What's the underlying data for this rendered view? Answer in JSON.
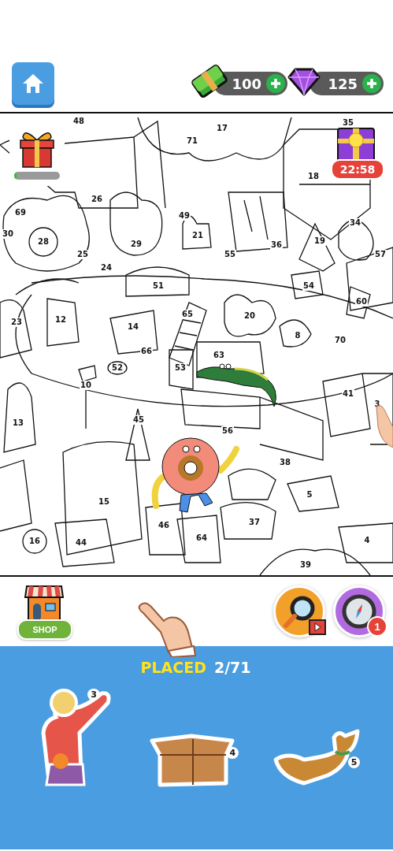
{
  "header": {
    "currencies": [
      {
        "kind": "cash",
        "amount": "100"
      },
      {
        "kind": "gem",
        "amount": "125"
      }
    ]
  },
  "canvas": {
    "labels": [
      "48",
      "17",
      "71",
      "35",
      "18",
      "26",
      "69",
      "49",
      "21",
      "30",
      "28",
      "29",
      "25",
      "24",
      "55",
      "36",
      "19",
      "34",
      "57",
      "54",
      "51",
      "60",
      "65",
      "20",
      "23",
      "12",
      "14",
      "8",
      "70",
      "66",
      "63",
      "52",
      "53",
      "10",
      "13",
      "45",
      "56",
      "41",
      "3",
      "38",
      "15",
      "5",
      "46",
      "37",
      "64",
      "16",
      "44",
      "4",
      "39"
    ],
    "chest": {
      "level": 0.06
    },
    "timed_gift": {
      "timer": "22:58"
    }
  },
  "toolbar": {
    "shop": "SHOP",
    "compass_badge": "1"
  },
  "progress": {
    "label": "PLACED",
    "count": "2/71"
  },
  "stickers": [
    {
      "kind": "person",
      "number": "3"
    },
    {
      "kind": "box",
      "number": "4"
    },
    {
      "kind": "dog",
      "number": "5"
    }
  ]
}
